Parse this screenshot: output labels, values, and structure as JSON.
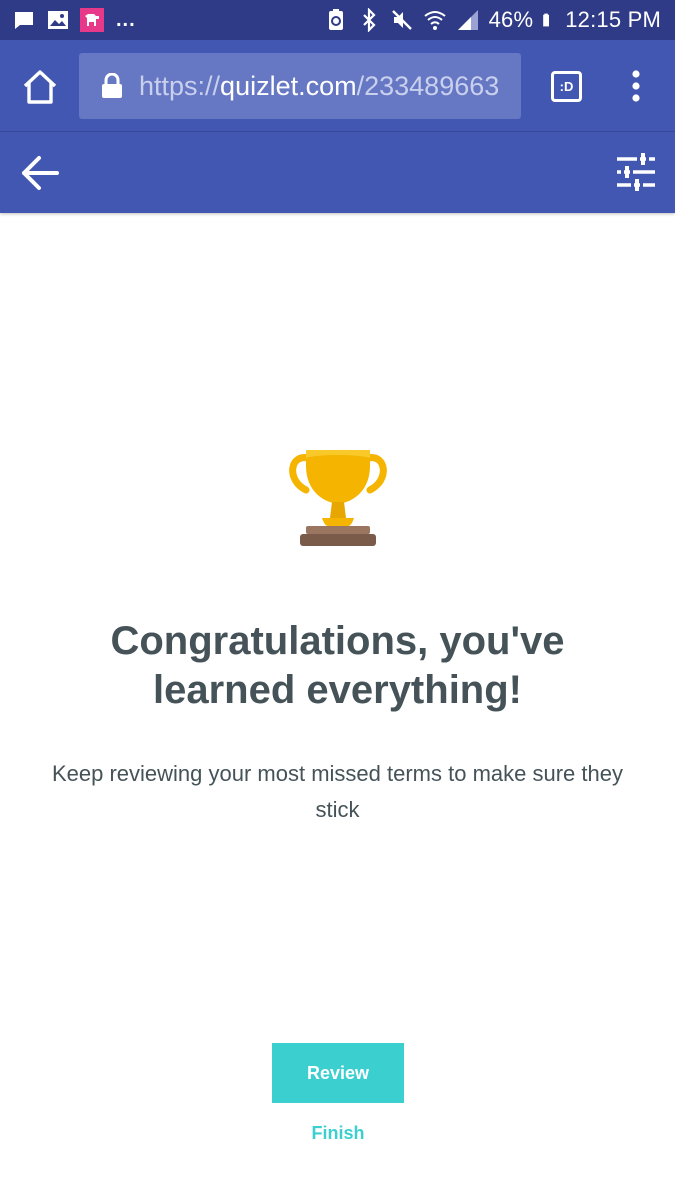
{
  "status_bar": {
    "battery": "46%",
    "time": "12:15 PM",
    "overflow": "...",
    "left_icons": [
      "message-icon",
      "image-icon",
      "app-notification-icon"
    ],
    "right_icons": [
      "battery-saver-icon",
      "bluetooth-icon",
      "mute-icon",
      "wifi-icon",
      "signal-icon",
      "battery-icon"
    ]
  },
  "browser": {
    "url_scheme": "https://",
    "url_host": "quizlet.com",
    "url_path": "/233489663",
    "tab_button_label": ":D",
    "icons": [
      "home-icon",
      "lock-icon",
      "more-vert-icon"
    ]
  },
  "app_header": {
    "icons": [
      "arrow-back-icon",
      "tune-icon"
    ]
  },
  "content": {
    "title_line1": "Congratulations, you've",
    "title_line2": "learned everything!",
    "subtitle_line1": "Keep reviewing your most missed terms to make sure they",
    "subtitle_line2": "stick",
    "icon": "trophy-icon"
  },
  "actions": {
    "review_label": "Review",
    "finish_label": "Finish"
  },
  "colors": {
    "status_bar": "#2f3b86",
    "primary": "#4257b2",
    "url_box": "#6677c3",
    "accent": "#3ccfcf",
    "text": "#455358",
    "trophy_gold": "#f4b400",
    "trophy_base": "#7a5a48"
  }
}
